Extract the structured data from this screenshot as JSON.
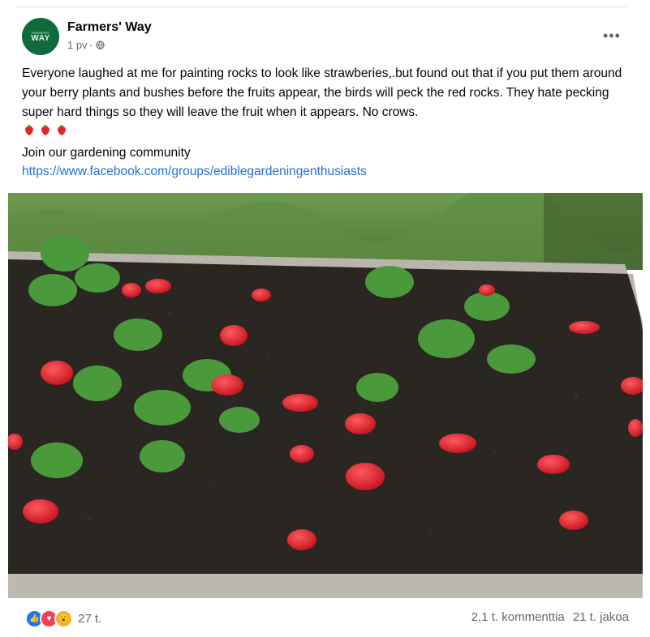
{
  "post": {
    "author": "Farmers' Way",
    "avatar_text_small": "FARMERS'",
    "avatar_text": "WAY",
    "time": "1 pv",
    "separator": "·",
    "text": "Everyone laughed at me for painting rocks to look like strawberies,.but found out that if you put them around your berry plants and bushes before the fruits appear, the birds will peck the red rocks. They hate pecking super hard things so they will leave the fruit when it appears. No crows.",
    "emoji_count": 3,
    "join_text": "Join our gardening community",
    "link": "https://www.facebook.com/groups/ediblegardeningenthusiasts"
  },
  "photo": {
    "description_icon": "raised-garden-bed-with-painted-strawberry-rocks"
  },
  "footer": {
    "reaction_count": "27 t.",
    "comments": "2,1 t. kommenttia",
    "shares": "21 t. jakoa"
  },
  "colors": {
    "brand_green": "#0f6b3b",
    "link_blue": "#216fdb",
    "meta_gray": "#65676b"
  }
}
